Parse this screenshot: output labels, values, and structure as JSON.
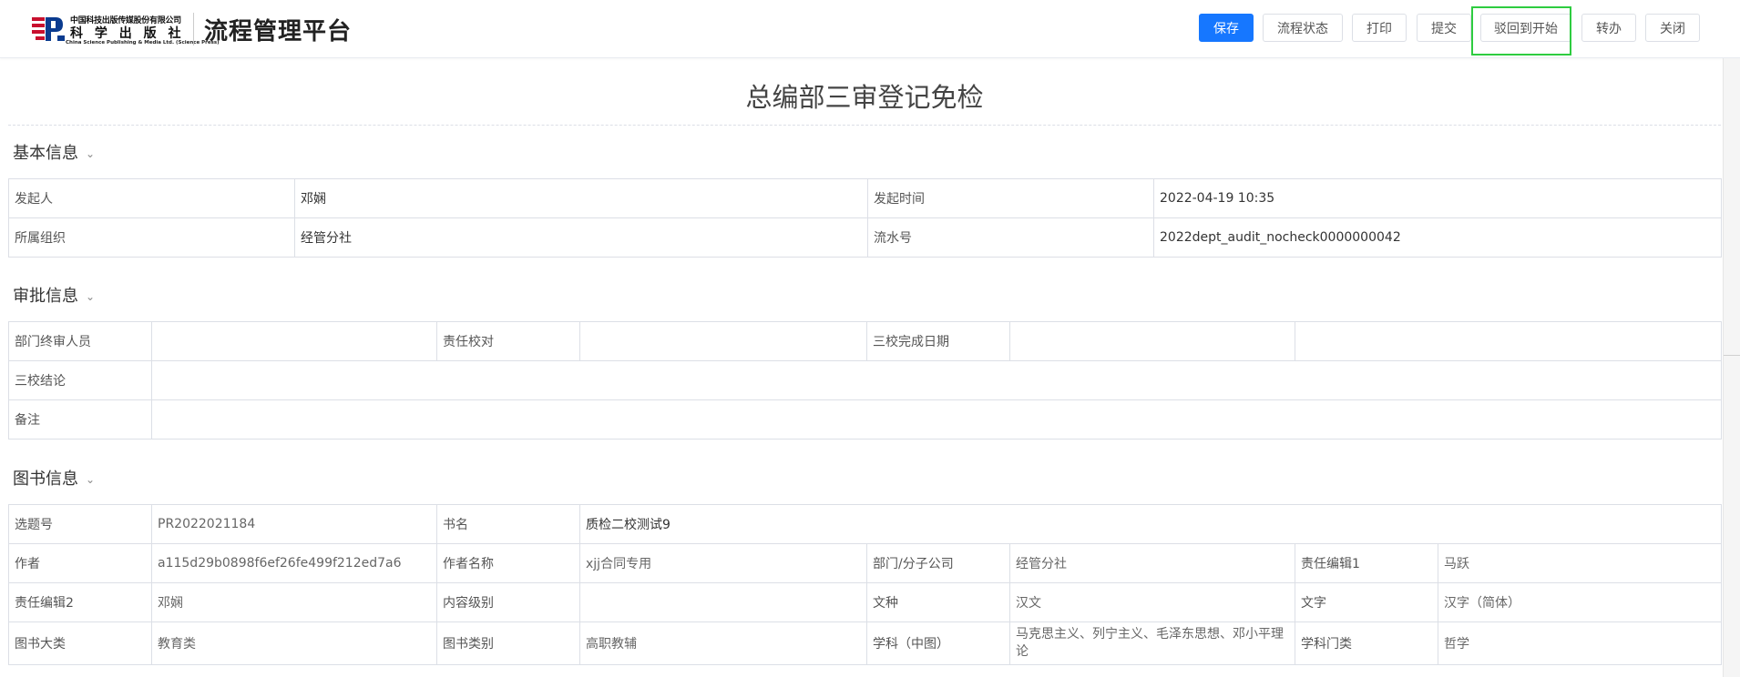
{
  "header": {
    "logo": {
      "icon": "science-press-logo-icon",
      "line1": "中国科技出版传媒股份有限公司",
      "line2": "科 学 出 版 社",
      "line3": "China Science Publishing & Media Ltd. (Science Press)"
    },
    "app_title": "流程管理平台"
  },
  "toolbar": {
    "save": "保存",
    "flow_status": "流程状态",
    "print": "打印",
    "submit": "提交",
    "reject_to_start": "驳回到开始",
    "transfer": "转办",
    "close": "关闭",
    "primary_color": "#1677ff",
    "highlight_color": "#2ecc40"
  },
  "form": {
    "title": "总编部三审登记免检"
  },
  "basic": {
    "heading": "基本信息",
    "initiator_label": "发起人",
    "initiator_value": "邓娴",
    "start_time_label": "发起时间",
    "start_time_value": "2022-04-19 10:35",
    "org_label": "所属组织",
    "org_value": "经管分社",
    "serial_label": "流水号",
    "serial_value": "2022dept_audit_nocheck0000000042"
  },
  "approval": {
    "heading": "审批信息",
    "final_reviewer_label": "部门终审人员",
    "final_reviewer_value": "",
    "proofreader_label": "责任校对",
    "proofreader_value": "",
    "third_proof_date_label": "三校完成日期",
    "third_proof_date_value": "",
    "third_proof_conclusion_label": "三校结论",
    "third_proof_conclusion_value": "",
    "remark_label": "备注",
    "remark_value": ""
  },
  "book": {
    "heading": "图书信息",
    "topic_no_label": "选题号",
    "topic_no_value": "PR2022021184",
    "title_label": "书名",
    "title_value": "质检二校测试9",
    "author_label": "作者",
    "author_value": "a115d29b0898f6ef26fe499f212ed7a6",
    "author_name_label": "作者名称",
    "author_name_value": "xjj合同专用",
    "dept_label": "部门/分子公司",
    "dept_value": "经管分社",
    "editor1_label": "责任编辑1",
    "editor1_value": "马跃",
    "editor2_label": "责任编辑2",
    "editor2_value": "邓娴",
    "content_level_label": "内容级别",
    "content_level_value": "",
    "language_label": "文种",
    "language_value": "汉文",
    "script_label": "文字",
    "script_value": "汉字（简体）",
    "category_label": "图书大类",
    "category_value": "教育类",
    "book_type_label": "图书类别",
    "book_type_value": "高职教辅",
    "subject_label": "学科（中图）",
    "subject_value": "马克思主义、列宁主义、毛泽东思想、邓小平理论",
    "discipline_label": "学科门类",
    "discipline_value": "哲学"
  }
}
